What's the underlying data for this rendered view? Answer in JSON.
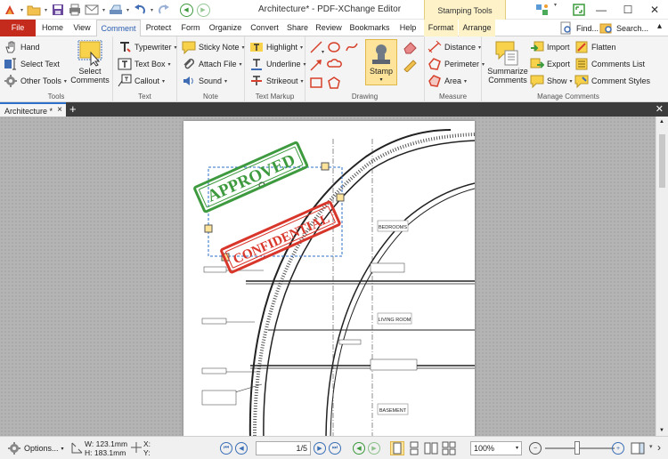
{
  "window": {
    "title": "Architecture* - PDF-XChange Editor",
    "context_header": "Stamping Tools",
    "min": "—",
    "max": "☐",
    "close": "✕"
  },
  "tabs": [
    "File",
    "Home",
    "View",
    "Comment",
    "Protect",
    "Form",
    "Organize",
    "Convert",
    "Share",
    "Review",
    "Bookmarks",
    "Help",
    "Format",
    "Arrange"
  ],
  "active_tab": "Comment",
  "find": {
    "find_label": "Find...",
    "search_label": "Search..."
  },
  "ribbon": {
    "tools": {
      "label": "Tools",
      "hand": "Hand",
      "select_text": "Select Text",
      "other_tools": "Other Tools",
      "select_comments_1": "Select",
      "select_comments_2": "Comments"
    },
    "text": {
      "label": "Text",
      "typewriter": "Typewriter",
      "text_box": "Text Box",
      "callout": "Callout"
    },
    "note": {
      "label": "Note",
      "sticky_note": "Sticky Note",
      "attach_file": "Attach File",
      "sound": "Sound"
    },
    "markup": {
      "label": "Text Markup",
      "highlight": "Highlight",
      "underline": "Underline",
      "strikeout": "Strikeout"
    },
    "drawing": {
      "label": "Drawing",
      "stamp": "Stamp"
    },
    "measure": {
      "label": "Measure",
      "distance": "Distance",
      "perimeter": "Perimeter",
      "area": "Area"
    },
    "manage": {
      "label": "Manage Comments",
      "summarize_1": "Summarize",
      "summarize_2": "Comments",
      "import": "Import",
      "export": "Export",
      "show": "Show",
      "flatten": "Flatten",
      "comments_list": "Comments List",
      "comment_styles": "Comment Styles"
    }
  },
  "document_tab": {
    "name": "Architecture *"
  },
  "drawing": {
    "stamp_approved": "APPROVED",
    "stamp_confidential": "CONFIDENTIAL",
    "room_bedrooms": "BEDROOMS",
    "room_living": "LIVING ROOM",
    "room_basement": "BASEMENT"
  },
  "status": {
    "options": "Options...",
    "width": "W: 123.1mm",
    "height": "H: 183.1mm",
    "x": "X:",
    "y": "Y:",
    "page": "1/5",
    "zoom": "100%"
  },
  "colors": {
    "file_tab": "#c42b1c",
    "accent": "#2a5db0",
    "approved": "#3e9a3e",
    "confidential": "#d8362b",
    "selection": "#2a6fc9"
  }
}
